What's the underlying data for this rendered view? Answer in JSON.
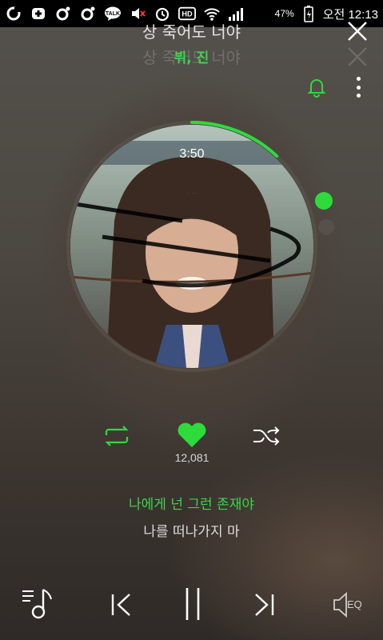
{
  "status_bar": {
    "battery_percent": "47%",
    "time": "오전 12:13",
    "icons": [
      "app-o-icon",
      "plus-badge-icon",
      "circle-dot-icon",
      "circle-dot-icon",
      "kakaotalk-icon",
      "mute-volume-icon",
      "alarm-icon",
      "hd-icon",
      "wifi-icon",
      "signal-icon",
      "battery-charging-icon"
    ]
  },
  "player": {
    "song_title": "상 죽어도 너야",
    "song_title_ghost": "상 죽어도 너야",
    "artist": "뷔, 진",
    "elapsed_time": "3:50",
    "progress_fraction": 0.12,
    "like_count": "12,081",
    "liked": true
  },
  "lyrics": {
    "current": "나에게 넌 그런 존재야",
    "next": "나를 떠나가지 마"
  },
  "bottom_controls": {
    "eq_label": "EQ"
  },
  "colors": {
    "accent": "#2ddb3d"
  }
}
